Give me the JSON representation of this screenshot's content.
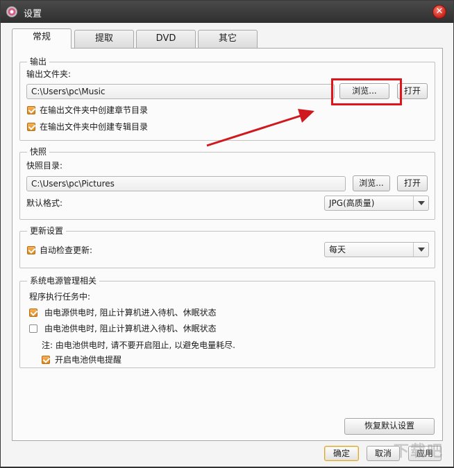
{
  "window": {
    "title": "设置",
    "close_glyph": "✕"
  },
  "tabs": [
    {
      "label": "常规",
      "active": true
    },
    {
      "label": "提取",
      "active": false
    },
    {
      "label": "DVD",
      "active": false
    },
    {
      "label": "其它",
      "active": false
    }
  ],
  "output": {
    "group_title": "输出",
    "folder_label": "输出文件夹:",
    "folder_value": "C:\\Users\\pc\\Music",
    "browse_label": "浏览...",
    "open_label": "打开",
    "checkbox1": {
      "label": "在输出文件夹中创建章节目录",
      "checked": true
    },
    "checkbox2": {
      "label": "在输出文件夹中创建专辑目录",
      "checked": true
    }
  },
  "snapshot": {
    "group_title": "快照",
    "dir_label": "快照目录:",
    "dir_value": "C:\\Users\\pc\\Pictures",
    "browse_label": "浏览...",
    "open_label": "打开",
    "format_label": "默认格式:",
    "format_value": "JPG(高质量)"
  },
  "update": {
    "group_title": "更新设置",
    "auto_check": {
      "label": "自动检查更新:",
      "checked": true
    },
    "frequency_value": "每天"
  },
  "power": {
    "group_title": "系统电源管理相关",
    "during_label": "程序执行任务中:",
    "ac_option": {
      "label": "由电源供电时, 阻止计算机进入待机、休眠状态",
      "checked": true
    },
    "battery_option": {
      "label": "由电池供电时, 阻止计算机进入待机、休眠状态",
      "checked": false
    },
    "note": "注: 由电池供电时, 请不要开启阻止, 以避免电量耗尽.",
    "battery_reminder": {
      "label": "开启电池供电提醒",
      "checked": true
    }
  },
  "footer": {
    "restore_defaults_label": "恢复默认设置",
    "ok_label": "确定",
    "cancel_label": "取消",
    "apply_label": "应用"
  },
  "annotation": {
    "highlight_color": "#e0151b",
    "arrow_color": "#d0191e"
  },
  "watermark": {
    "text": "下载吧"
  }
}
